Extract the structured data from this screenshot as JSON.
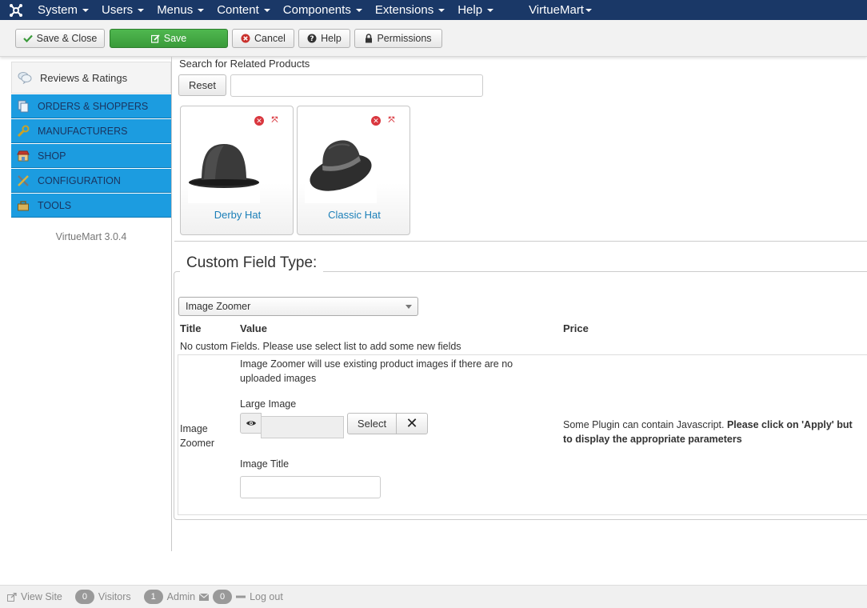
{
  "topnav": {
    "items": [
      {
        "label": "System"
      },
      {
        "label": "Users"
      },
      {
        "label": "Menus"
      },
      {
        "label": "Content"
      },
      {
        "label": "Components"
      },
      {
        "label": "Extensions"
      },
      {
        "label": "Help"
      }
    ],
    "virtuemart": "VirtueMart"
  },
  "toolbar": {
    "save_close": "Save & Close",
    "save": "Save",
    "cancel": "Cancel",
    "help": "Help",
    "permissions": "Permissions"
  },
  "sidebar": {
    "reviews": "Reviews & Ratings",
    "items": [
      {
        "label": "ORDERS & SHOPPERS"
      },
      {
        "label": "MANUFACTURERS"
      },
      {
        "label": "SHOP"
      },
      {
        "label": "CONFIGURATION"
      },
      {
        "label": "TOOLS"
      }
    ],
    "version": "VirtueMart 3.0.4"
  },
  "related": {
    "search_label": "Search for Related Products",
    "reset": "Reset",
    "search_value": "",
    "products": [
      {
        "name": "Derby Hat"
      },
      {
        "name": "Classic Hat"
      }
    ]
  },
  "custom": {
    "legend": "Custom Field Type:",
    "selected": "Image Zoomer",
    "headers": {
      "title": "Title",
      "value": "Value",
      "price": "Price"
    },
    "no_fields": "No custom Fields. Please use select list to add some new fields",
    "row": {
      "title_line1": "Image",
      "title_line2": "Zoomer",
      "desc": "Image Zoomer will use existing product images if there are no uploaded images",
      "large_image": "Large Image",
      "select": "Select",
      "image_title": "Image Title",
      "image_title_value": "",
      "price_note_plain": "Some Plugin can contain Javascript. ",
      "price_note_bold1": "Please click on 'Apply' but",
      "price_note_bold2": "to display the appropriate parameters"
    }
  },
  "statusbar": {
    "view_site": "View Site",
    "visitors_count": "0",
    "visitors": "Visitors",
    "admin_count": "1",
    "admin": "Admin",
    "messages_count": "0",
    "logout": "Log out"
  }
}
